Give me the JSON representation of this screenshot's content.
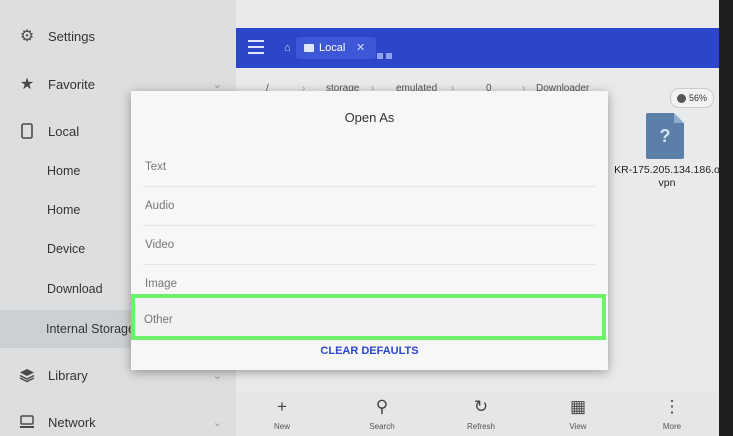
{
  "sidebar": {
    "items": [
      {
        "label": "Settings",
        "icon": "gear-icon"
      },
      {
        "label": "Favorite",
        "icon": "star-icon"
      },
      {
        "label": "Local",
        "icon": "phone-icon"
      }
    ],
    "sub_items": [
      {
        "label": "Home"
      },
      {
        "label": "Home"
      },
      {
        "label": "Device"
      },
      {
        "label": "Download"
      },
      {
        "label": "Internal Storage"
      }
    ],
    "library": {
      "label": "Library",
      "icon": "layers-icon"
    },
    "network": {
      "label": "Network",
      "icon": "network-icon"
    }
  },
  "topbar": {
    "tab_label": "Local"
  },
  "breadcrumb": [
    "/",
    "storage",
    "emulated",
    "0",
    "Downloader"
  ],
  "storage_badge": "56%",
  "file": {
    "name": "KR-175.205.134.186.ovpn",
    "name_line1": "KR-175.205.134.186.o",
    "name_line2": "vpn",
    "icon_glyph": "?"
  },
  "toolbar": {
    "items": [
      {
        "label": "New",
        "glyph": "+"
      },
      {
        "label": "Search",
        "glyph": "⚲"
      },
      {
        "label": "Refresh",
        "glyph": "↻"
      },
      {
        "label": "View",
        "glyph": "▦"
      },
      {
        "label": "More",
        "glyph": "⋮"
      }
    ]
  },
  "dialog": {
    "title": "Open As",
    "options": [
      "Text",
      "Audio",
      "Video",
      "Image",
      "Other"
    ],
    "highlighted_option": "Other",
    "clear_button": "CLEAR DEFAULTS"
  },
  "colors": {
    "accent": "#2b46c9",
    "highlight": "#6ff06a"
  }
}
